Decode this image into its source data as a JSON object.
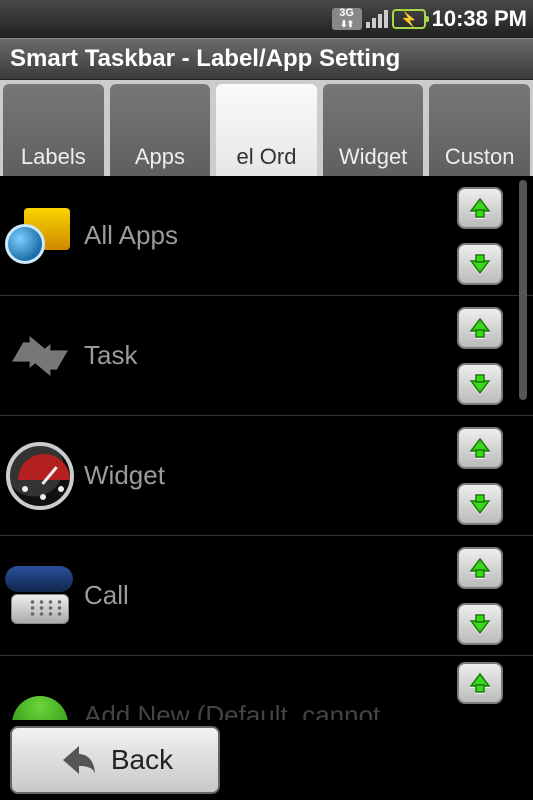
{
  "status": {
    "network": "3G",
    "time": "10:38 PM"
  },
  "header": {
    "title": "Smart Taskbar - Label/App Setting"
  },
  "tabs": [
    {
      "label": "Labels",
      "active": false
    },
    {
      "label": "Apps",
      "active": false
    },
    {
      "label": "el Ord",
      "active": true
    },
    {
      "label": "Widget",
      "active": false
    },
    {
      "label": "Custon",
      "active": false
    }
  ],
  "items": [
    {
      "label": "All Apps",
      "icon": "all-apps"
    },
    {
      "label": "Task",
      "icon": "task"
    },
    {
      "label": "Widget",
      "icon": "widget"
    },
    {
      "label": "Call",
      "icon": "call"
    },
    {
      "label": "Add New (Default, cannot",
      "icon": "add"
    }
  ],
  "footer": {
    "back_label": "Back"
  }
}
